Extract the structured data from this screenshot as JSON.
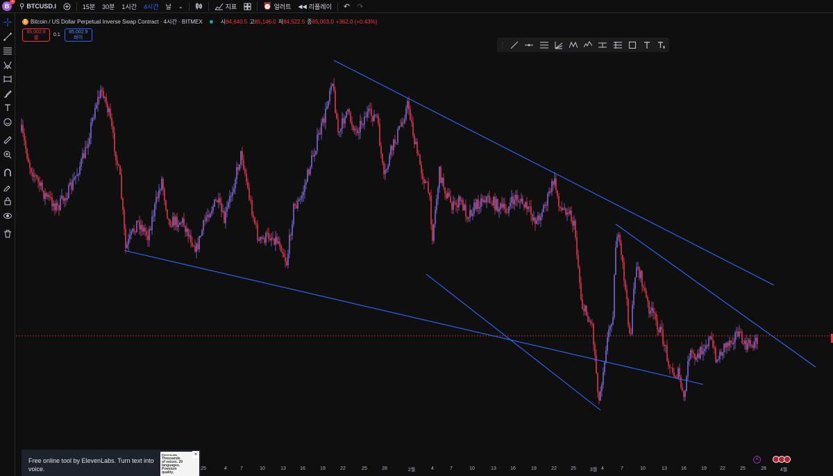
{
  "topbar": {
    "avatar_letter": "B",
    "avatar_badge": "1",
    "symbol": "BTCUSD.I",
    "intervals": [
      "15분",
      "30분",
      "1시간",
      "4시간",
      "날"
    ],
    "active_interval": "4시간",
    "indicators_label": "지표",
    "alert_label": "얼러트",
    "replay_label": "리플레이"
  },
  "legend": {
    "title": "Bitcoin / US Dollar Perpetual Inverse Swap Contract · 4시간 · BITMEX",
    "open_key": "시",
    "open": "84,640.5",
    "high_key": "고",
    "high": "85,146.0",
    "low_key": "저",
    "low": "84,522.5",
    "close_key": "종",
    "close": "85,003.0",
    "change": "+362.0 (+0.43%)"
  },
  "order": {
    "sell_price": "85,002.8",
    "sell_label": "셀",
    "spread": "0.1",
    "buy_price": "85,002.9",
    "buy_label": "바이"
  },
  "time_axis": [
    "25",
    "4",
    "7",
    "10",
    "13",
    "16",
    "19",
    "22",
    "25",
    "28",
    "2월",
    "4",
    "7",
    "10",
    "13",
    "16",
    "19",
    "22",
    "25",
    "3월",
    "4",
    "7",
    "10",
    "13",
    "16",
    "19",
    "22",
    "25",
    "28",
    "4월"
  ],
  "ad": {
    "text": "Free online tool by ElevenLabs. Turn text into voice.",
    "thumb_title": "ElevenLabs",
    "thumb_headline": "Thousands of voices. 29 languages. Premium quality.",
    "close": "×"
  },
  "colors": {
    "background": "#0f0f0f",
    "candle_up": "#7b6bdc",
    "candle_down": "#e0394f",
    "trendline": "#2f6bff",
    "price_line": "#f23645"
  },
  "chart_data": {
    "type": "candlestick",
    "title": "",
    "note": "BTCUSD perpetual 4h price, values read approximately from the picture",
    "trendlines": 4
  }
}
